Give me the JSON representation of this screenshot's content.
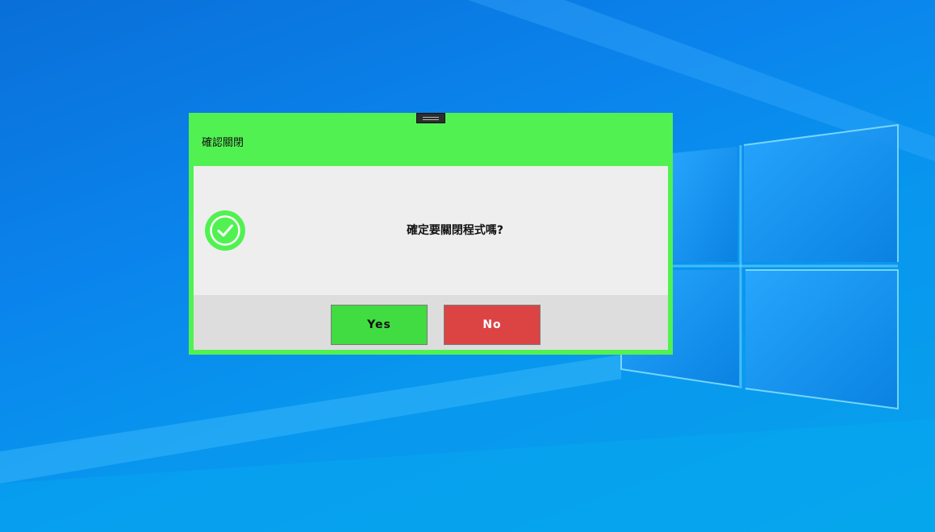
{
  "dialog": {
    "title": "確認關閉",
    "message": "確定要關閉程式嗎?",
    "icon": "check-circle-icon",
    "yes_label": "Yes",
    "no_label": "No"
  },
  "colors": {
    "dialog_frame": "#52f152",
    "dialog_body": "#eeeeee",
    "dialog_footer": "#dddddd",
    "yes_button": "#41dc41",
    "no_button": "#dc4444",
    "check_icon": "#52f152",
    "desktop": "#0a84ec"
  }
}
